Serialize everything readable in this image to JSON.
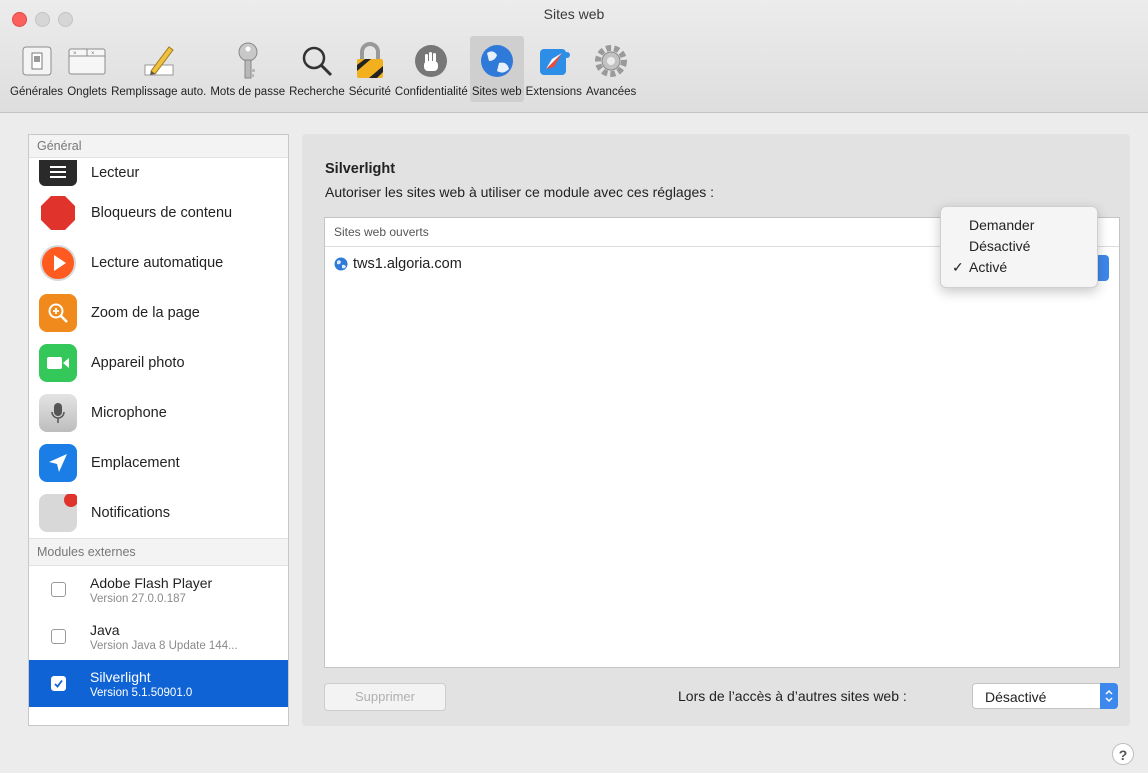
{
  "window": {
    "title": "Sites web"
  },
  "toolbar": {
    "items": [
      {
        "label": "Générales",
        "icon": "general-switch-icon"
      },
      {
        "label": "Onglets",
        "icon": "tabs-icon"
      },
      {
        "label": "Remplissage auto.",
        "icon": "pencil-icon"
      },
      {
        "label": "Mots de passe",
        "icon": "key-icon"
      },
      {
        "label": "Recherche",
        "icon": "magnifier-icon"
      },
      {
        "label": "Sécurité",
        "icon": "padlock-icon"
      },
      {
        "label": "Confidentialité",
        "icon": "hand-icon"
      },
      {
        "label": "Sites web",
        "icon": "globe-icon",
        "active": true
      },
      {
        "label": "Extensions",
        "icon": "extensions-icon"
      },
      {
        "label": "Avancées",
        "icon": "gear-icon"
      }
    ]
  },
  "sidebar": {
    "general_header": "Général",
    "items": [
      {
        "label": "Lecteur",
        "icon": "reader-icon",
        "color": "#2a2a2a"
      },
      {
        "label": "Bloqueurs de contenu",
        "icon": "stop-sign-icon",
        "color": "#e0332c"
      },
      {
        "label": "Lecture automatique",
        "icon": "play-icon",
        "color": "#ff5a1f"
      },
      {
        "label": "Zoom de la page",
        "icon": "zoom-icon",
        "color": "#f08a1c"
      },
      {
        "label": "Appareil photo",
        "icon": "camera-icon",
        "color": "#34c759"
      },
      {
        "label": "Microphone",
        "icon": "microphone-icon",
        "color": "#c9c9c9"
      },
      {
        "label": "Emplacement",
        "icon": "location-arrow-icon",
        "color": "#1a7ee6"
      },
      {
        "label": "Notifications",
        "icon": "notification-badge-icon",
        "color": "#d8d8d8"
      }
    ],
    "modules_header": "Modules externes",
    "modules": [
      {
        "name": "Adobe Flash Player",
        "version": "Version 27.0.0.187",
        "checked": false
      },
      {
        "name": "Java",
        "version": "Version Java 8 Update 144...",
        "checked": false
      },
      {
        "name": "Silverlight",
        "version": "Version 5.1.50901.0",
        "checked": true,
        "selected": true
      }
    ]
  },
  "main": {
    "plugin_title": "Silverlight",
    "description": "Autoriser les sites web à utiliser ce module avec ces réglages :",
    "sites_header": "Sites web ouverts",
    "sites": [
      {
        "domain": "tws1.algoria.com",
        "setting": "Activé"
      }
    ],
    "remove_button": "Supprimer",
    "other_sites_label": "Lors de l’accès à d’autres sites web :",
    "other_sites_value": "Désactivé"
  },
  "dropdown": {
    "options": [
      "Demander",
      "Désactivé",
      "Activé"
    ],
    "selected": "Activé",
    "check_mark": "✓"
  },
  "help": {
    "label": "?"
  },
  "colors": {
    "accent": "#0f63d4",
    "popup_blue": "#3d88ec"
  }
}
